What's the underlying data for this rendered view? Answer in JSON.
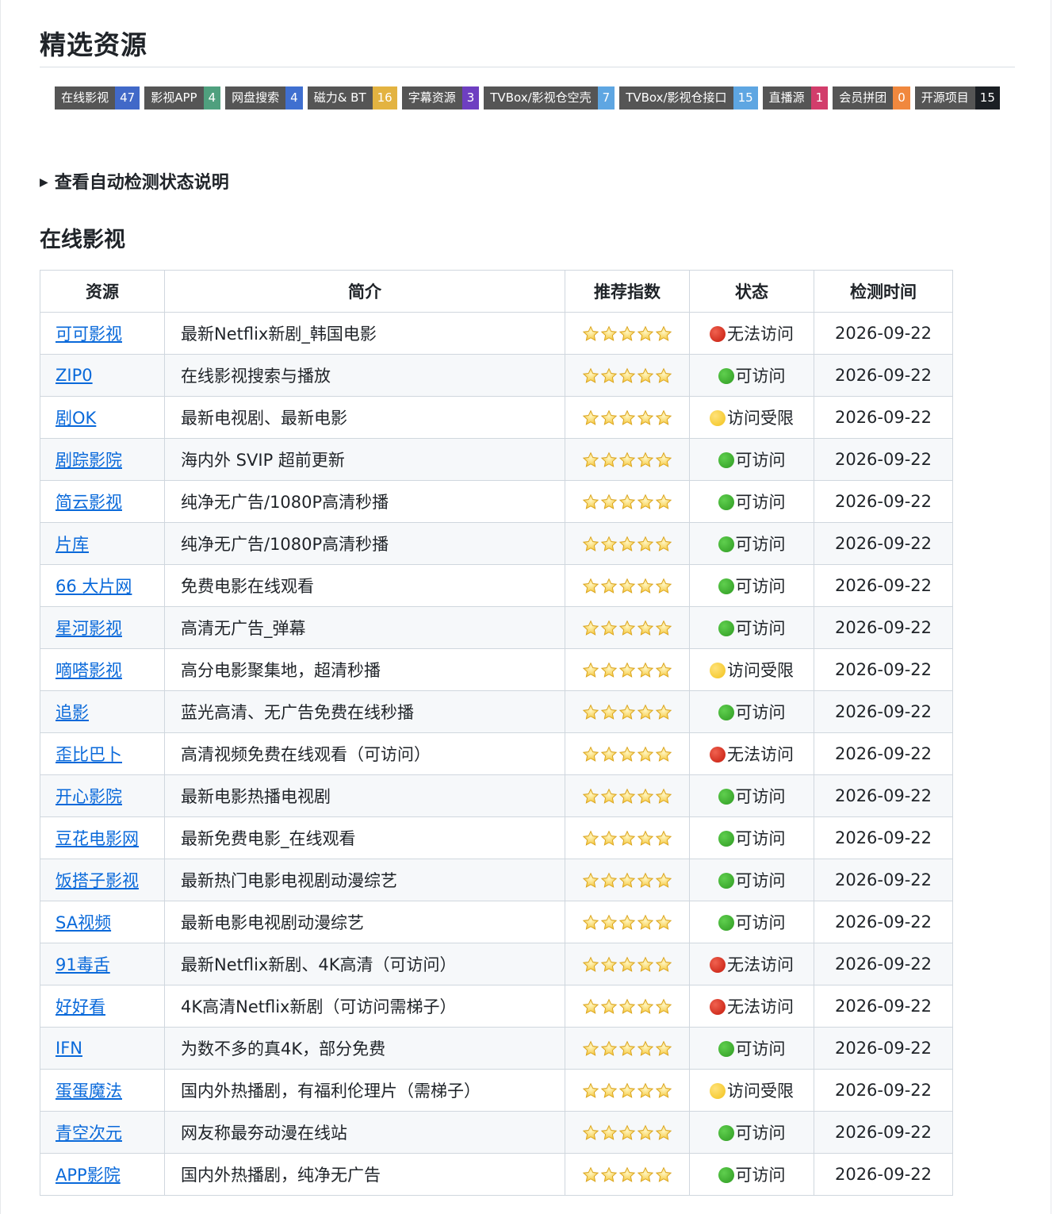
{
  "page": {
    "title": "精选资源"
  },
  "badges": [
    {
      "label": "在线影视",
      "count": "47",
      "color": "#4169c8"
    },
    {
      "label": "影视APP",
      "count": "4",
      "color": "#4fa07e"
    },
    {
      "label": "网盘搜索",
      "count": "4",
      "color": "#3f6fd0"
    },
    {
      "label": "磁力& BT",
      "count": "16",
      "color": "#e3b341"
    },
    {
      "label": "字幕资源",
      "count": "3",
      "color": "#6e3fc1"
    },
    {
      "label": "TVBox/影视仓空壳",
      "count": "7",
      "color": "#5ea6e2"
    },
    {
      "label": "TVBox/影视仓接口",
      "count": "15",
      "color": "#5ea6e2"
    },
    {
      "label": "直播源",
      "count": "1",
      "color": "#d23d6b"
    },
    {
      "label": "会员拼团",
      "count": "0",
      "color": "#f0883e"
    },
    {
      "label": "开源项目",
      "count": "15",
      "color": "#1b1f24"
    }
  ],
  "details_summary": "查看自动检测状态说明",
  "section_title": "在线影视",
  "table": {
    "headers": [
      "资源",
      "简介",
      "推荐指数",
      "状态",
      "检测时间"
    ],
    "rows": [
      {
        "name": "可可影视",
        "desc": "最新Netflix新剧_韩国电影",
        "stars": 5,
        "status": "无法访问",
        "status_color": "red",
        "date": "2026-09-22"
      },
      {
        "name": "ZIP0",
        "desc": "在线影视搜索与播放",
        "stars": 5,
        "status": "可访问",
        "status_color": "green",
        "date": "2026-09-22"
      },
      {
        "name": "剧OK",
        "desc": "最新电视剧、最新电影",
        "stars": 5,
        "status": "访问受限",
        "status_color": "yellow",
        "date": "2026-09-22"
      },
      {
        "name": "剧踪影院",
        "desc": "海内外 SVIP 超前更新",
        "stars": 5,
        "status": "可访问",
        "status_color": "green",
        "date": "2026-09-22"
      },
      {
        "name": "简云影视",
        "desc": "纯净无广告/1080P高清秒播",
        "stars": 5,
        "status": "可访问",
        "status_color": "green",
        "date": "2026-09-22"
      },
      {
        "name": "片库",
        "desc": "纯净无广告/1080P高清秒播",
        "stars": 5,
        "status": "可访问",
        "status_color": "green",
        "date": "2026-09-22"
      },
      {
        "name": "66 大片网",
        "desc": "免费电影在线观看",
        "stars": 5,
        "status": "可访问",
        "status_color": "green",
        "date": "2026-09-22"
      },
      {
        "name": "星河影视",
        "desc": "高清无广告_弹幕",
        "stars": 5,
        "status": "可访问",
        "status_color": "green",
        "date": "2026-09-22"
      },
      {
        "name": "嘀嗒影视",
        "desc": "高分电影聚集地，超清秒播",
        "stars": 5,
        "status": "访问受限",
        "status_color": "yellow",
        "date": "2026-09-22"
      },
      {
        "name": "追影",
        "desc": "蓝光高清、无广告免费在线秒播",
        "stars": 5,
        "status": "可访问",
        "status_color": "green",
        "date": "2026-09-22"
      },
      {
        "name": "歪比巴卜",
        "desc": "高清视频免费在线观看（可访问）",
        "stars": 5,
        "status": "无法访问",
        "status_color": "red",
        "date": "2026-09-22"
      },
      {
        "name": "开心影院",
        "desc": "最新电影热播电视剧",
        "stars": 5,
        "status": "可访问",
        "status_color": "green",
        "date": "2026-09-22"
      },
      {
        "name": "豆花电影网",
        "desc": "最新免费电影_在线观看",
        "stars": 5,
        "status": "可访问",
        "status_color": "green",
        "date": "2026-09-22"
      },
      {
        "name": "饭搭子影视",
        "desc": "最新热门电影电视剧动漫综艺",
        "stars": 5,
        "status": "可访问",
        "status_color": "green",
        "date": "2026-09-22"
      },
      {
        "name": "SA视频",
        "desc": "最新电影电视剧动漫综艺",
        "stars": 5,
        "status": "可访问",
        "status_color": "green",
        "date": "2026-09-22"
      },
      {
        "name": "91毒舌",
        "desc": "最新Netflix新剧、4K高清（可访问）",
        "stars": 5,
        "status": "无法访问",
        "status_color": "red",
        "date": "2026-09-22"
      },
      {
        "name": "好好看",
        "desc": "4K高清Netflix新剧（可访问需梯子）",
        "stars": 5,
        "status": "无法访问",
        "status_color": "red",
        "date": "2026-09-22"
      },
      {
        "name": "IFN",
        "desc": "为数不多的真4K，部分免费",
        "stars": 5,
        "status": "可访问",
        "status_color": "green",
        "date": "2026-09-22"
      },
      {
        "name": "蛋蛋魔法",
        "desc": "国内外热播剧，有福利伦理片（需梯子）",
        "stars": 5,
        "status": "访问受限",
        "status_color": "yellow",
        "date": "2026-09-22"
      },
      {
        "name": "青空次元",
        "desc": "网友称最夯动漫在线站",
        "stars": 5,
        "status": "可访问",
        "status_color": "green",
        "date": "2026-09-22"
      },
      {
        "name": "APP影院",
        "desc": "国内外热播剧，纯净无广告",
        "stars": 5,
        "status": "可访问",
        "status_color": "green",
        "date": "2026-09-22"
      }
    ]
  }
}
